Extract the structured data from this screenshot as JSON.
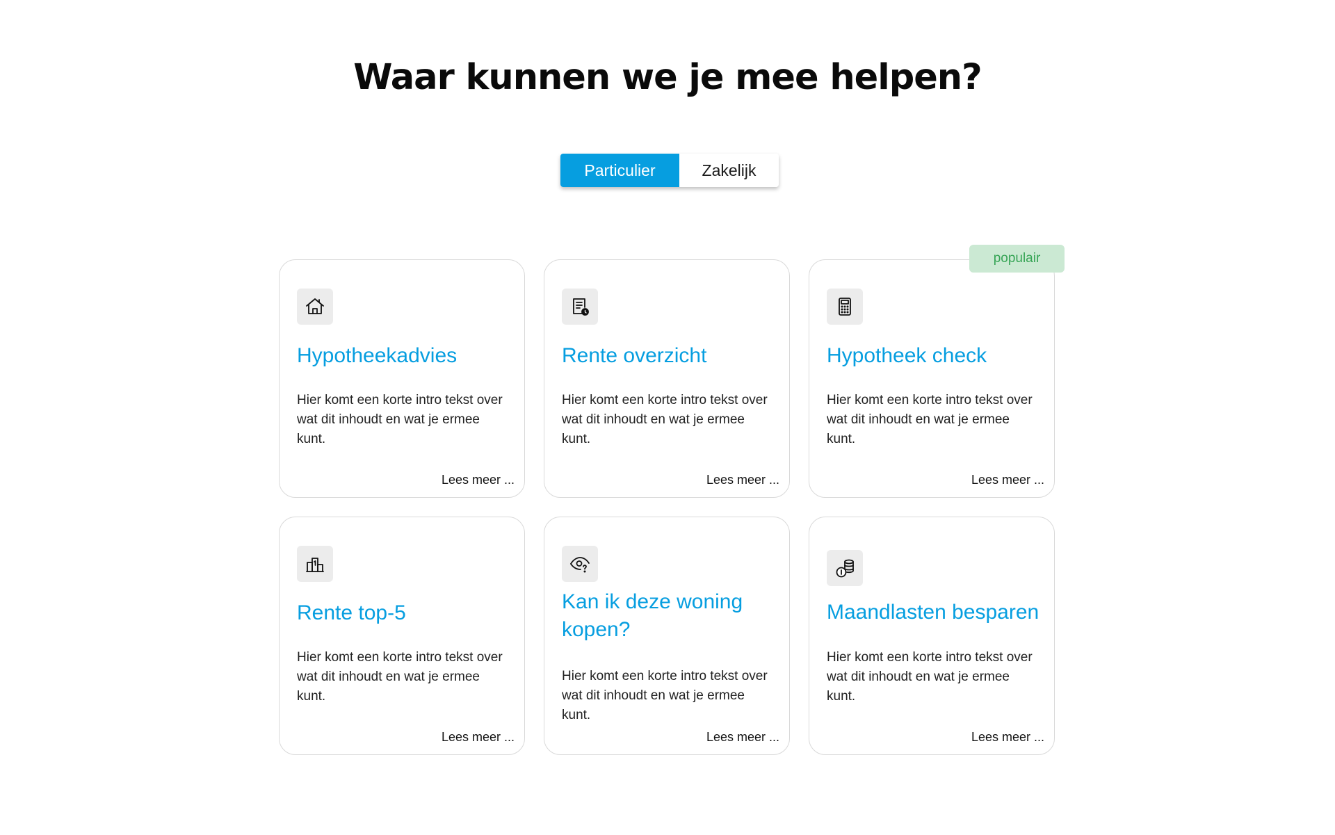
{
  "heading": "Waar kunnen we je mee helpen?",
  "toggle": {
    "options": [
      "Particulier",
      "Zakelijk"
    ],
    "selected": "Particulier"
  },
  "badge": "populair",
  "cards": [
    {
      "title": "Hypotheekadvies",
      "icon": "house-icon",
      "text": "Hier komt een korte intro tekst over wat dit inhoudt en wat je ermee kunt.",
      "link": "Lees meer ..."
    },
    {
      "title": "Rente overzicht",
      "icon": "document-clock-icon",
      "text": "Hier komt een korte intro tekst over wat dit inhoudt en wat je ermee kunt.",
      "link": "Lees meer ..."
    },
    {
      "title": "Hypotheek check",
      "icon": "calculator-icon",
      "text": "Hier komt een korte intro tekst over wat dit inhoudt en wat je ermee kunt.",
      "link": "Lees meer ..."
    },
    {
      "title": "Rente top-5",
      "icon": "podium-icon",
      "text": "Hier komt een korte intro tekst over wat dit inhoudt en wat je ermee kunt.",
      "link": "Lees meer ..."
    },
    {
      "title": "Kan ik deze woning kopen?",
      "icon": "eye-question-icon",
      "text": "Hier komt een korte intro tekst over wat dit inhoudt en wat je ermee kunt.",
      "link": "Lees meer ..."
    },
    {
      "title": "Maandlasten besparen",
      "icon": "coins-icon",
      "text": "Hier komt een korte intro tekst over wat dit inhoudt en wat je ermee kunt.",
      "link": "Lees meer ..."
    }
  ],
  "colors": {
    "accent": "#069ee0",
    "badge_bg": "#cbe9d3",
    "badge_text": "#37a556",
    "icon_bg": "#ececec"
  }
}
